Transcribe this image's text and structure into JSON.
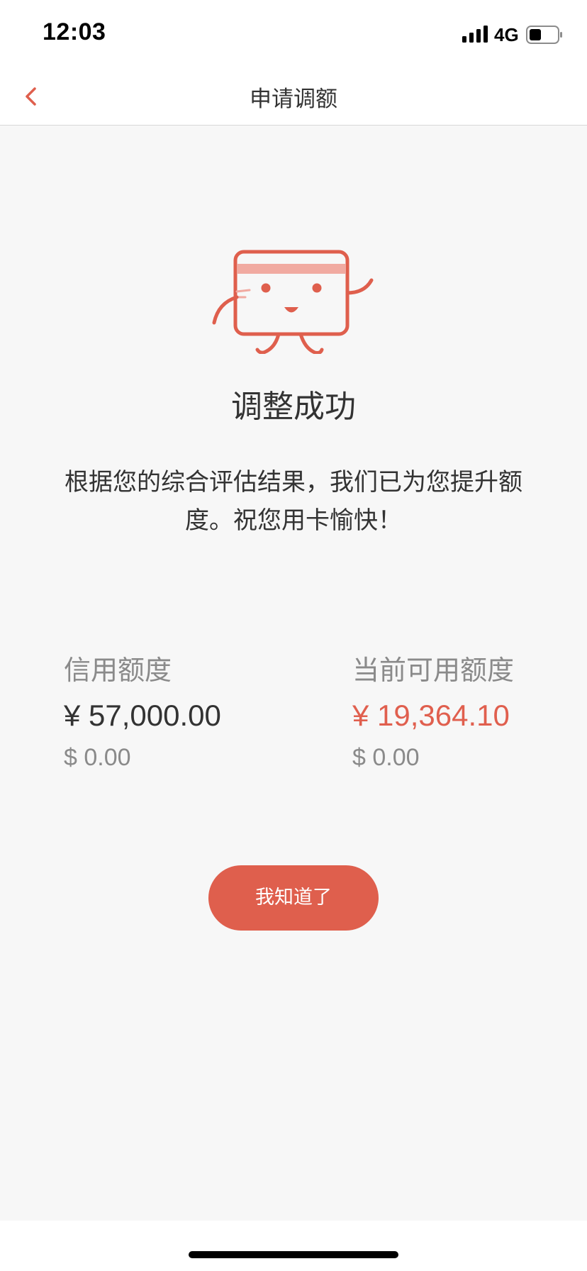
{
  "status_bar": {
    "time": "12:03",
    "network": "4G",
    "icons": [
      "signal-icon",
      "battery-icon"
    ]
  },
  "nav": {
    "title": "申请调额",
    "back_icon": "chevron-left-icon"
  },
  "result": {
    "illustration": "card-mascot-illustration",
    "title": "调整成功",
    "description": "根据您的综合评估结果，我们已为您提升额度。祝您用卡愉快！"
  },
  "limits": {
    "credit": {
      "label": "信用额度",
      "cny": "¥ 57,000.00",
      "usd": "$ 0.00"
    },
    "available": {
      "label": "当前可用额度",
      "cny": "¥ 19,364.10",
      "usd": "$ 0.00"
    }
  },
  "actions": {
    "confirm_label": "我知道了"
  },
  "colors": {
    "accent": "#df5f4d",
    "background": "#f7f7f7",
    "text_primary": "#333333",
    "text_secondary": "#8a8a8a"
  }
}
